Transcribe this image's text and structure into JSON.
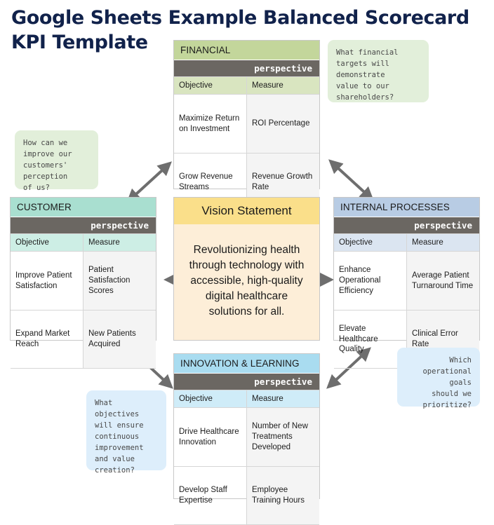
{
  "title": "Google Sheets Example Balanced Scorecard KPI Template",
  "common": {
    "perspective_label": "perspective",
    "col_objective": "Objective",
    "col_measure": "Measure"
  },
  "colors": {
    "financial_header": "#c3d69b",
    "customer_header": "#a9dfd0",
    "internal_header": "#b8cce4",
    "innovation_header": "#a9dcf0",
    "vision_header": "#fadf8a",
    "vision_body": "#fdeed8",
    "perspective_band": "#6b6762",
    "note_green": "#e2efda",
    "note_blue": "#ddeefb",
    "arrow": "#6e6e6e",
    "title_text": "#11224b"
  },
  "perspectives": {
    "financial": {
      "title": "FINANCIAL",
      "rows": [
        {
          "objective": "Maximize Return on Investment",
          "measure": "ROI Percentage"
        },
        {
          "objective": "Grow Revenue Streams",
          "measure": "Revenue Growth Rate"
        }
      ]
    },
    "customer": {
      "title": "CUSTOMER",
      "rows": [
        {
          "objective": "Improve Patient Satisfaction",
          "measure": "Patient Satisfaction Scores"
        },
        {
          "objective": "Expand Market Reach",
          "measure": "New Patients Acquired"
        }
      ]
    },
    "internal": {
      "title": "INTERNAL PROCESSES",
      "rows": [
        {
          "objective": "Enhance Operational Efficiency",
          "measure": "Average Patient Turnaround Time"
        },
        {
          "objective": "Elevate Healthcare Quality",
          "measure": "Clinical Error Rate"
        }
      ]
    },
    "innovation": {
      "title": "INNOVATION & LEARNING",
      "rows": [
        {
          "objective": "Drive Healthcare Innovation",
          "measure": "Number of New Treatments Developed"
        },
        {
          "objective": "Develop Staff Expertise",
          "measure": "Employee Training Hours"
        }
      ]
    }
  },
  "vision": {
    "heading": "Vision Statement",
    "body": "Revolutionizing health through technology with accessible, high-quality digital healthcare solutions for all."
  },
  "notes": {
    "financial": "What financial\ntargets will\ndemonstrate\nvalue to our\nshareholders?",
    "customer": "How can we\nimprove our\ncustomers'\nperception\nof us?",
    "internal": "Which\noperational\ngoals\nshould we\nprioritize?",
    "innovation": "What\nobjectives\nwill ensure\ncontinuous\nimprovement\nand value\ncreation?"
  }
}
